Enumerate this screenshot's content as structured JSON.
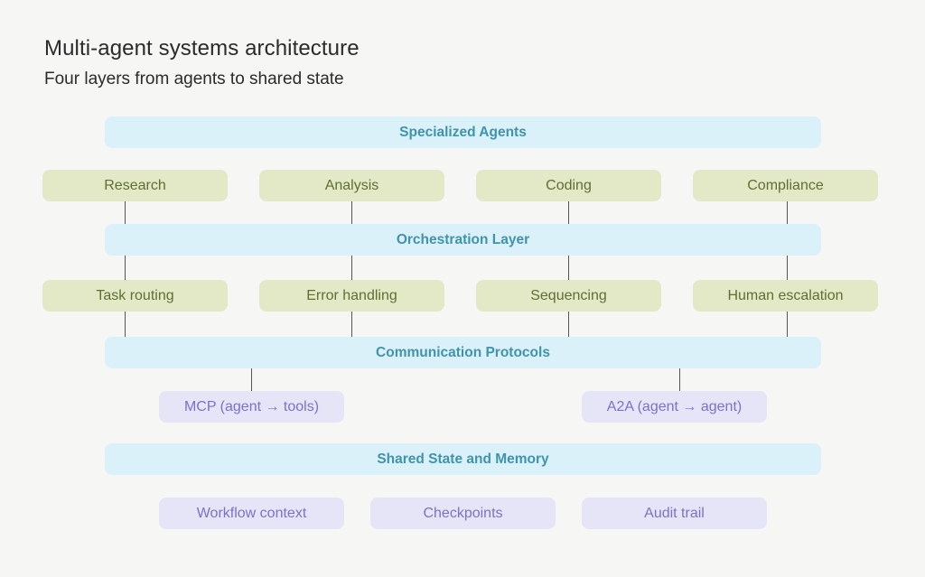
{
  "diagram": {
    "title": "Multi-agent systems architecture",
    "subtitle": "Four layers from agents to shared state",
    "layers": [
      {
        "label": "Specialized Agents",
        "items": [
          "Research",
          "Analysis",
          "Coding",
          "Compliance"
        ]
      },
      {
        "label": "Orchestration Layer",
        "items": [
          "Task routing",
          "Error handling",
          "Sequencing",
          "Human escalation"
        ]
      },
      {
        "label": "Communication Protocols",
        "items": [
          "MCP (agent → tools)",
          "A2A (agent → agent)"
        ]
      },
      {
        "label": "Shared State and Memory",
        "items": [
          "Workflow context",
          "Checkpoints",
          "Audit trail"
        ]
      }
    ],
    "colors": {
      "background": "#f6f6f4",
      "layer_fill": "#dbf1fa",
      "layer_text": "#3f94ac",
      "agent_fill": "#e3e8c6",
      "agent_text": "#5f6f32",
      "protocol_fill": "#e6e5f8",
      "protocol_text": "#7a72c6",
      "connector": "#555555"
    }
  }
}
